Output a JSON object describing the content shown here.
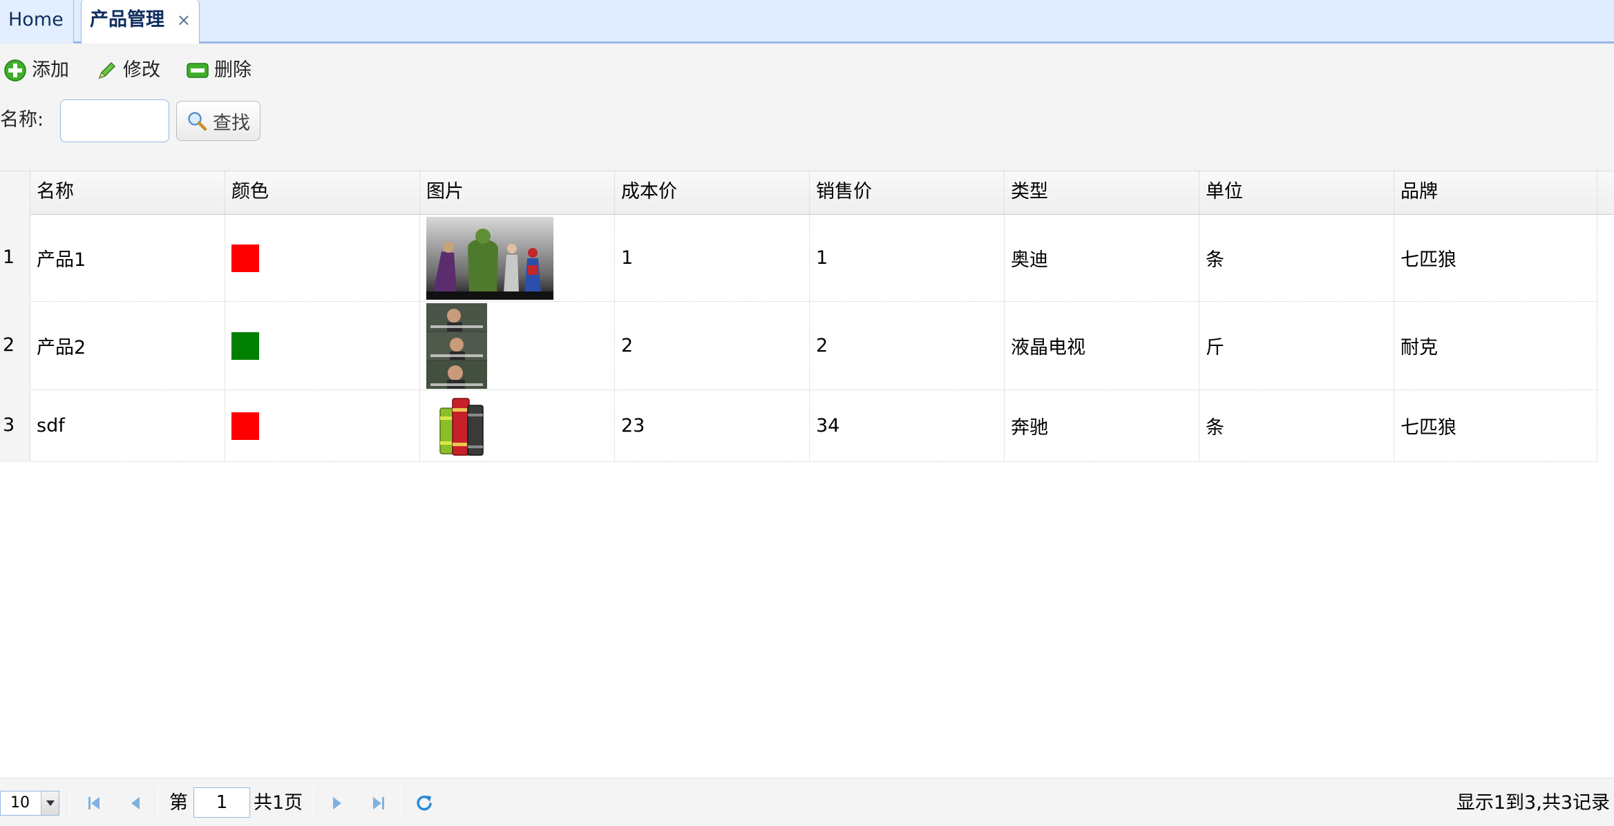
{
  "tabs": [
    {
      "label": "Home"
    },
    {
      "label": "产品管理",
      "close": "×"
    }
  ],
  "toolbar": {
    "add_label": "添加",
    "edit_label": "修改",
    "delete_label": "删除"
  },
  "search": {
    "label": "名称:",
    "value": "",
    "placeholder": "",
    "button_label": "查找"
  },
  "grid": {
    "columns": [
      "名称",
      "颜色",
      "图片",
      "成本价",
      "销售价",
      "类型",
      "单位",
      "品牌"
    ],
    "rows": [
      {
        "num": "1",
        "name": "产品1",
        "color": "#ff0000",
        "image": "superhero-figures-photo",
        "cost": "1",
        "price": "1",
        "type": "奥迪",
        "unit": "条",
        "brand": "七匹狼"
      },
      {
        "num": "2",
        "name": "产品2",
        "color": "#008000",
        "image": "meme-faces-photo",
        "cost": "2",
        "price": "2",
        "type": "液晶电视",
        "unit": "斤",
        "brand": "耐克"
      },
      {
        "num": "3",
        "name": "sdf",
        "color": "#ff0000",
        "image": "books-icon",
        "cost": "23",
        "price": "34",
        "type": "奔驰",
        "unit": "条",
        "brand": "七匹狼"
      }
    ]
  },
  "pager": {
    "page_size": "10",
    "page_prefix": "第",
    "page_value": "1",
    "page_suffix": "共1页",
    "info": "显示1到3,共3记录"
  },
  "colors": {
    "tab_bar": "#e0ecff",
    "border_accent": "#95b8e7",
    "panel": "#f4f4f4"
  }
}
